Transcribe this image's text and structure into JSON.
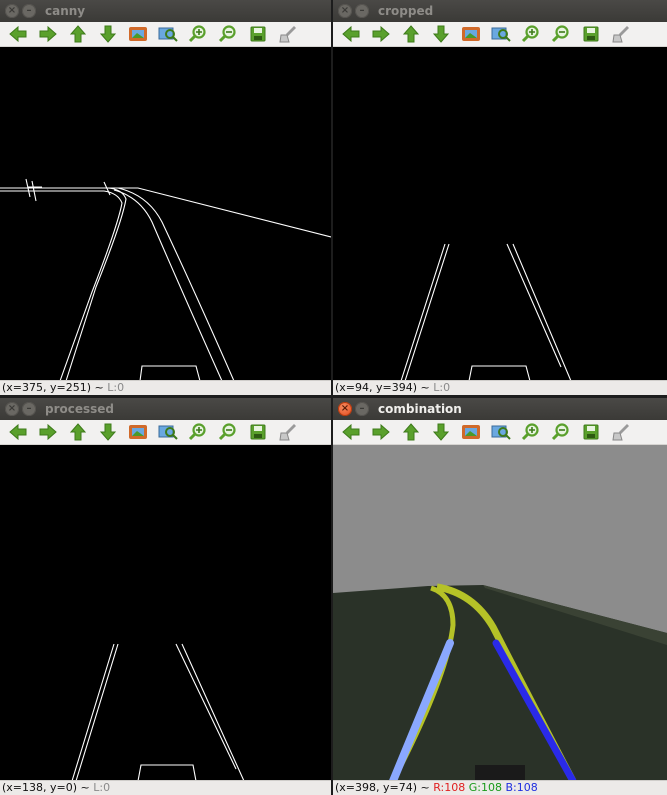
{
  "windows": [
    {
      "title": "canny",
      "status": "(x=375, y=251) ~",
      "level": "L:0"
    },
    {
      "title": "cropped",
      "status": "(x=94, y=394) ~",
      "level": "L:0"
    },
    {
      "title": "processed",
      "status": "(x=138, y=0) ~",
      "level": "L:0"
    },
    {
      "title": "combination",
      "status": "(x=398, y=74) ~",
      "r": "R:108",
      "g": "G:108",
      "b": "B:108"
    }
  ],
  "toolbar_icons": [
    "arrow-left-icon",
    "arrow-right-icon",
    "arrow-up-icon",
    "arrow-down-icon",
    "image-icon",
    "zoom-region-icon",
    "zoom-in-icon",
    "zoom-out-icon",
    "save-icon",
    "properties-icon"
  ],
  "colors": {
    "icon_green": "#5aa02c",
    "lane_yellow": "#b5c227",
    "lane_blue": "#2a2ae8",
    "lane_lightblue": "#8aa8ff",
    "road": "#2a3228",
    "sky": "#8c8c8c"
  }
}
